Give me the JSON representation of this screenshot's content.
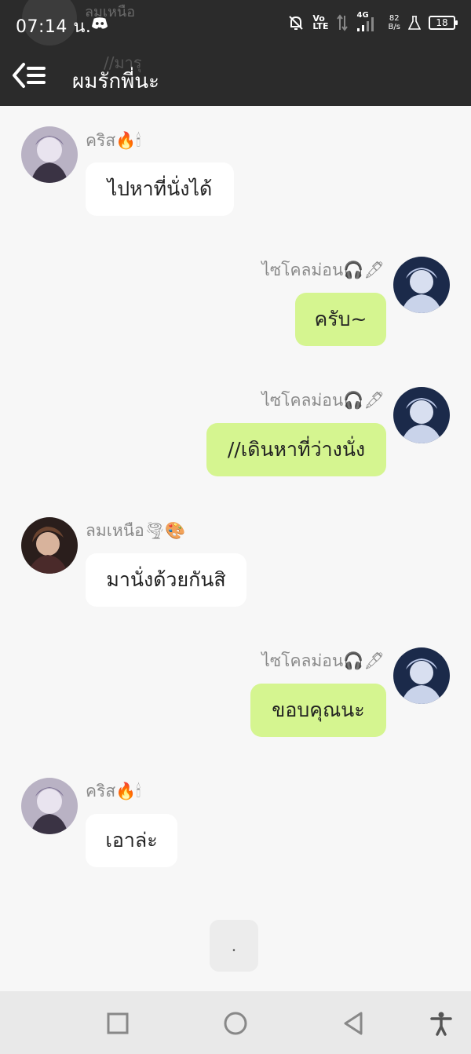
{
  "status_bar": {
    "time": "07:14 น.",
    "volte_top": "Vo",
    "volte_bottom": "LTE",
    "network": "4G",
    "speed_value": "82",
    "speed_unit": "B/s",
    "battery": "18"
  },
  "header": {
    "title": "ผมรักพี่นะ"
  },
  "background_ghost": {
    "name": "ลมเหนือ",
    "text": "//มารุ"
  },
  "messages": [
    {
      "sender": "คริส🔥🕯",
      "text": "ไปหาที่นั่งได้",
      "direction": "incoming"
    },
    {
      "sender": "ไซโคลม่อน🎧🖋",
      "text": "ครับ~",
      "direction": "outgoing"
    },
    {
      "sender": "ไซโคลม่อน🎧🖋",
      "text": "//เดินหาที่ว่างนั่ง",
      "direction": "outgoing"
    },
    {
      "sender": "ลมเหนือ🌪🎨",
      "text": "มานั่งด้วยกันสิ",
      "direction": "incoming"
    },
    {
      "sender": "ไซโคลม่อน🎧🖋",
      "text": "ขอบคุณนะ",
      "direction": "outgoing"
    },
    {
      "sender": "คริส🔥🕯",
      "text": "เอาล่ะ",
      "direction": "incoming"
    }
  ],
  "typing_indicator": ".",
  "colors": {
    "header_bg": "#2b2b2b",
    "chat_bg": "#f7f7f7",
    "outgoing_bubble": "#d5f590",
    "incoming_bubble": "#ffffff",
    "sender_name": "#8a8a8a",
    "navbar_bg": "#e9e9e9"
  },
  "icons": {
    "back": "back-menu-icon",
    "discord": "discord-icon",
    "mute": "bell-off-icon",
    "signal": "signal-icon",
    "flask": "flask-icon",
    "battery": "battery-icon",
    "nav_recent": "square-icon",
    "nav_home": "circle-icon",
    "nav_back": "triangle-back-icon",
    "accessibility": "accessibility-icon"
  }
}
